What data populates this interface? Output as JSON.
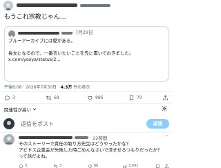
{
  "top_post": {
    "text": "もうこれ宗教じゃん…",
    "views_label": "件の表示",
    "time": "午後8:08 · 2026年7月30日 · ",
    "views": "4.3万",
    "more_icon": "more-dots-icon"
  },
  "quote": {
    "date": "· 7月29日",
    "lines": [
      "ブルーアーカイブには愛がある。",
      "",
      "長文になるので、一番言いたいことを先に書いておきました。",
      "x.com/ysoya/status/2..."
    ]
  },
  "actions": {
    "reply_count": "3",
    "retweet_count": "68",
    "like_count": "886",
    "bookmark_count": "70"
  },
  "sort": {
    "label": "関連性が高い"
  },
  "reply_box": {
    "placeholder": "返信をポスト",
    "button_label": "返信"
  },
  "reply_post": {
    "time": "· 22時間",
    "more": "···",
    "lines": [
      "そのストーリーで責任の取り方先生はどうやったかな？",
      "アビドス企業会が失敗した時ごめんなさいで済ませるつもりだったか？",
      "って話だよね。"
    ],
    "reply_count": "3",
    "retweet_count": "3",
    "like_count": "86",
    "views": "3,091"
  },
  "colors": {
    "accent": "#1d9bf0",
    "reply_button_bg": "#8ecdf8",
    "border": "#cfd9de",
    "text_muted": "#536471"
  }
}
